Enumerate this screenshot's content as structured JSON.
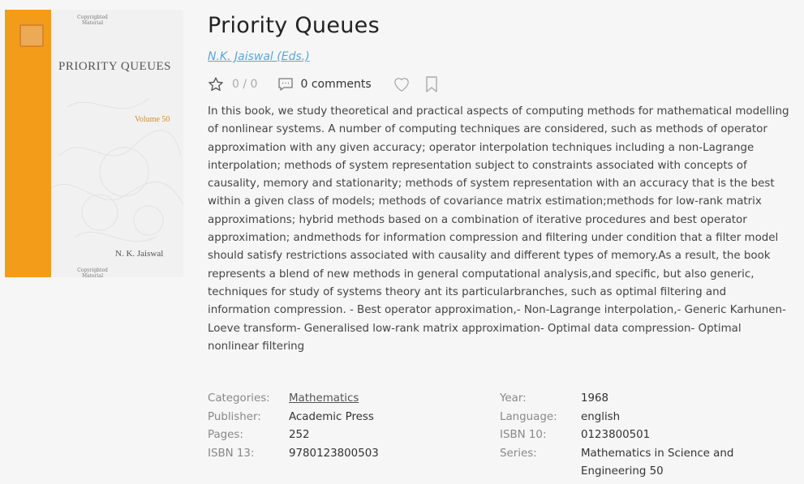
{
  "book": {
    "title": "Priority Queues",
    "author": "N.K. Jaiswal (Eds.)",
    "rating": "0",
    "rating_sep": "/",
    "rating_max": "0",
    "comments": "0 comments",
    "description": "In this book, we study theoretical and practical aspects of computing methods for mathematical modelling of nonlinear systems. A number of computing techniques are considered, such as methods of operator approximation with any given accuracy; operator interpolation techniques including a non-Lagrange interpolation; methods of system representation subject to constraints associated with concepts of causality, memory and stationarity; methods of system representation with an accuracy that is the best within a given class of models; methods of covariance matrix estimation;methods for low-rank matrix approximations; hybrid methods based on a combination of iterative procedures and best operator approximation; andmethods for information compression and filtering under condition that a filter model should satisfy restrictions associated with causality and different types of memory.As a result, the book represents a blend of new methods in general computational analysis,and specific, but also generic, techniques for study of systems theory ant its particularbranches, such as optimal filtering and information compression. - Best operator approximation,- Non-Lagrange interpolation,- Generic Karhunen-Loeve transform- Generalised low-rank matrix approximation- Optimal data compression- Optimal nonlinear filtering"
  },
  "cover": {
    "top_text": "Copyrighted Material",
    "title": "PRIORITY QUEUES",
    "volume": "Volume 50",
    "author": "N. K. Jaiswal",
    "bottom_text": "Copyrighted Material",
    "accent_color": "#f39c1a"
  },
  "meta_left": [
    {
      "key": "Categories:",
      "value": "Mathematics"
    },
    {
      "key": "Publisher:",
      "value": "Academic Press"
    },
    {
      "key": "Pages:",
      "value": "252"
    },
    {
      "key": "ISBN 13:",
      "value": "9780123800503"
    }
  ],
  "meta_right": [
    {
      "key": "Year:",
      "value": "1968"
    },
    {
      "key": "Language:",
      "value": "english"
    },
    {
      "key": "ISBN 10:",
      "value": "0123800501"
    },
    {
      "key": "Series:",
      "value": "Mathematics in Science and Engineering 50"
    }
  ],
  "icons": {
    "star": "star-outline",
    "comments": "comment-icon",
    "heart": "heart-outline",
    "bookmark": "bookmark-outline"
  }
}
